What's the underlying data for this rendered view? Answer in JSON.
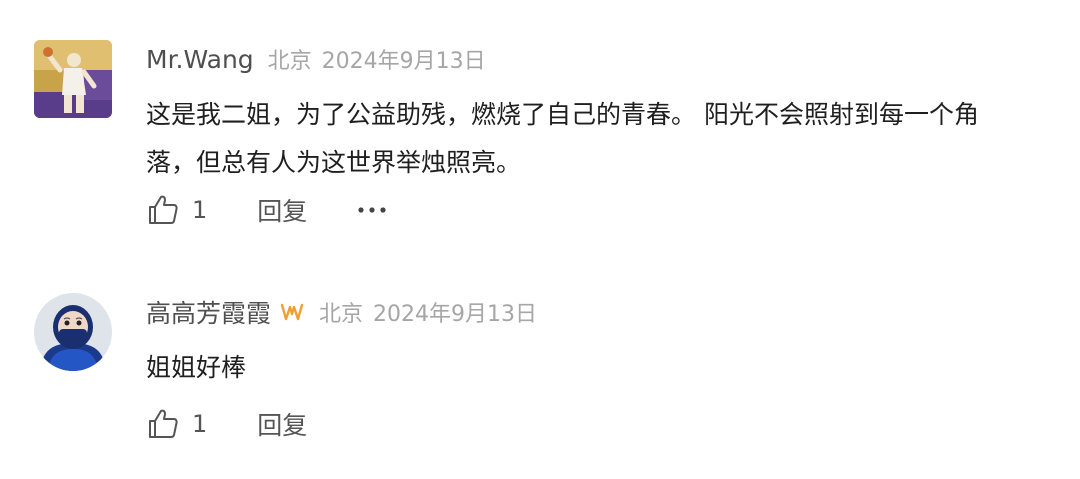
{
  "comments": [
    {
      "username": "Mr.Wang",
      "location": "北京",
      "date": "2024年9月13日",
      "text": "这是我二姐，为了公益助残，燃烧了自己的青春。 阳光不会照射到每一个角落，但总有人为这世界举烛照亮。",
      "likes": "1",
      "reply_label": "回复",
      "avatar_icon": "basketball-player-avatar",
      "has_more_menu": true
    },
    {
      "username": "高高芳霞霞",
      "badge_icon": "vip-badge-icon",
      "location": "北京",
      "date": "2024年9月13日",
      "text": "姐姐好棒",
      "likes": "1",
      "reply_label": "回复",
      "avatar_icon": "masked-person-avatar",
      "has_more_menu": false
    }
  ],
  "colors": {
    "username": "#4f4f4f",
    "meta": "#a6a6a6",
    "text": "#1f1f1f",
    "action": "#555555",
    "badge": "#f0a030"
  }
}
